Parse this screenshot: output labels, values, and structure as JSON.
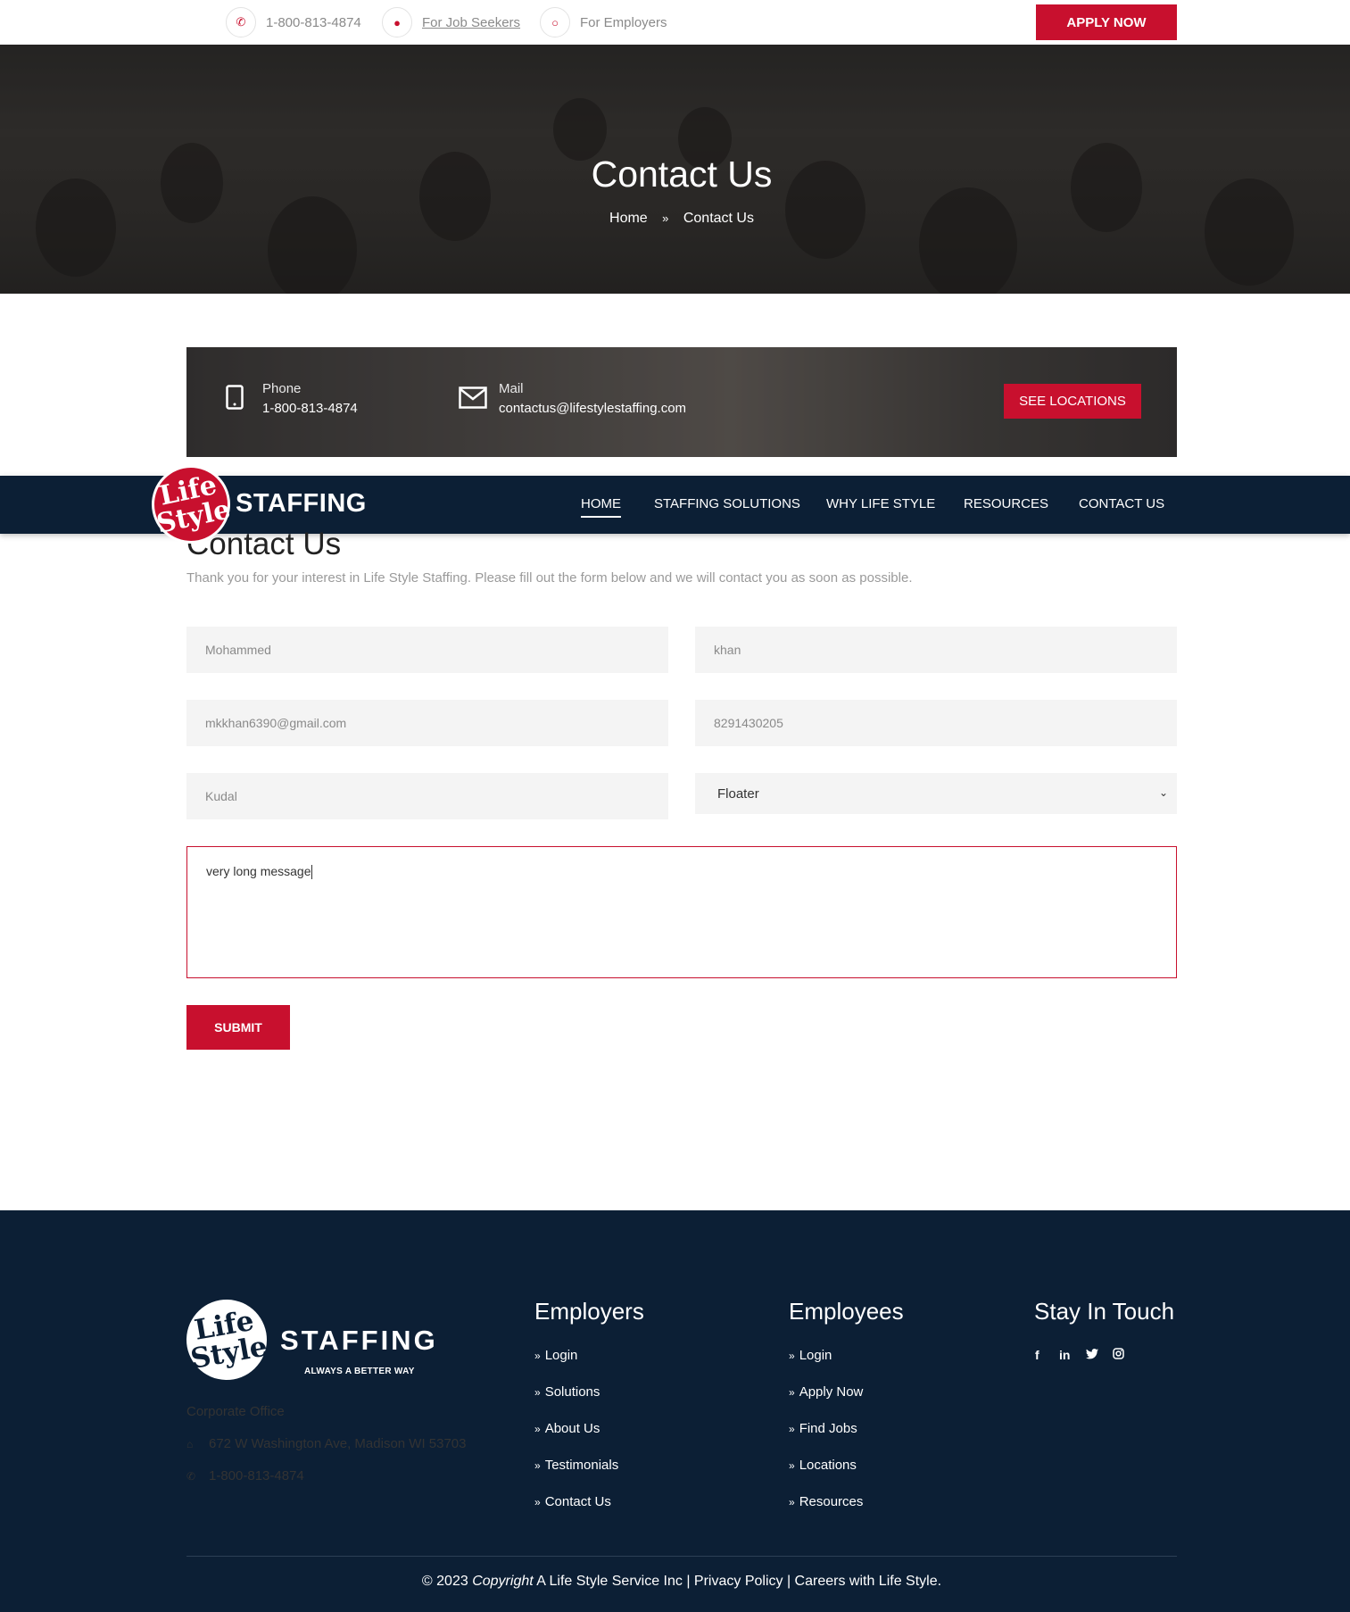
{
  "topbar": {
    "phone": "1-800-813-4874",
    "job_seekers": "For Job Seekers",
    "employers": "For Employers",
    "apply_now": "APPLY NOW"
  },
  "hero": {
    "title": "Contact Us",
    "breadcrumb_home": "Home",
    "breadcrumb_separator": "»",
    "breadcrumb_current": "Contact Us"
  },
  "info": {
    "phone_label": "Phone",
    "phone_value": "1-800-813-4874",
    "mail_label": "Mail",
    "mail_value": "contactus@lifestylestaffing.com",
    "see_locations": "SEE LOCATIONS"
  },
  "nav": {
    "logo_line1": "Life",
    "logo_line2": "Style",
    "logo_text": "STAFFING",
    "items": [
      {
        "label": "HOME",
        "active": true
      },
      {
        "label": "STAFFING SOLUTIONS",
        "active": false
      },
      {
        "label": "WHY LIFE STYLE",
        "active": false
      },
      {
        "label": "RESOURCES",
        "active": false
      },
      {
        "label": "CONTACT US",
        "active": false
      }
    ]
  },
  "form": {
    "title": "Contact Us",
    "subtitle": "Thank you for your interest in Life Style Staffing. Please fill out the form below and we will contact you as soon as possible.",
    "first_name": "Mohammed",
    "last_name": "khan",
    "email": "mkkhan6390@gmail.com",
    "phone": "8291430205",
    "city": "Kudal",
    "position": "Floater",
    "message": "very long message",
    "submit": "SUBMIT"
  },
  "footer": {
    "logo_line1": "Life",
    "logo_line2": "Style",
    "logo_text": "STAFFING",
    "tagline": "ALWAYS A BETTER WAY",
    "office_label": "Corporate Office",
    "address": "672 W Washington Ave, Madison WI 53703",
    "phone": "1-800-813-4874",
    "employers": {
      "heading": "Employers",
      "links": [
        "Login",
        "Solutions",
        "About Us",
        "Testimonials",
        "Contact Us"
      ]
    },
    "employees": {
      "heading": "Employees",
      "links": [
        "Login",
        "Apply Now",
        "Find Jobs",
        "Locations",
        "Resources"
      ]
    },
    "stay_in_touch": "Stay In Touch",
    "social": [
      "facebook-icon",
      "linkedin-icon",
      "twitter-icon",
      "instagram-icon"
    ],
    "copyright_prefix": "© 2023",
    "copyright_word": "Copyright",
    "copyright_rest": "A Life Style Service Inc | Privacy Policy | Careers with Life Style."
  },
  "colors": {
    "accent": "#c8102e",
    "navy": "#0c1f35",
    "field_bg": "#f4f4f4"
  }
}
